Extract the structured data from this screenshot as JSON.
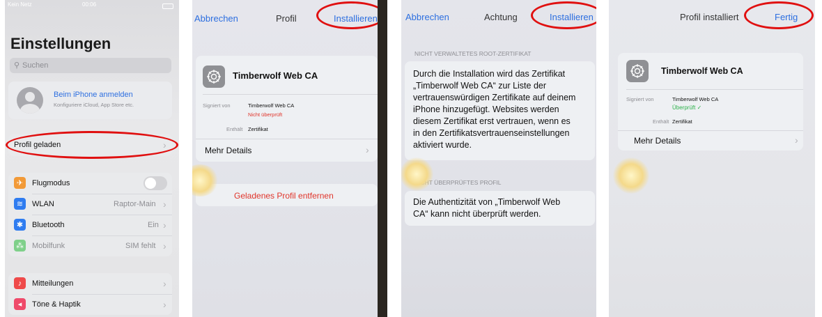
{
  "screen1": {
    "status_carrier": "Kein Netz",
    "status_time": "00:06",
    "title": "Einstellungen",
    "search_placeholder": "Suchen",
    "apple_id_title": "Beim iPhone anmelden",
    "apple_id_subtitle": "Konfiguriere iCloud, App Store etc.",
    "profile_loaded": "Profil geladen",
    "rows": [
      {
        "label": "Flugmodus",
        "value": ""
      },
      {
        "label": "WLAN",
        "value": "Raptor-Main"
      },
      {
        "label": "Bluetooth",
        "value": "Ein"
      },
      {
        "label": "Mobilfunk",
        "value": "SIM fehlt"
      }
    ],
    "rows2": [
      {
        "label": "Mitteilungen"
      },
      {
        "label": "Töne & Haptik"
      }
    ],
    "colors": {
      "airplane": "#f29a38",
      "wifi": "#2f7cf0",
      "bluetooth": "#2f7cf0",
      "cellular": "#7fd08a",
      "notifications": "#ef4a4a",
      "sounds": "#ef4a6a"
    }
  },
  "screen2": {
    "cancel": "Abbrechen",
    "title": "Profil",
    "install": "Installieren",
    "profile_name": "Timberwolf Web CA",
    "signed_label": "Signiert von",
    "signed_value": "Timberwolf Web CA",
    "signed_status": "Nicht überprüft",
    "contains_label": "Enthält",
    "contains_value": "Zertifikat",
    "more_details": "Mehr Details",
    "remove": "Geladenes Profil entfernen"
  },
  "screen3": {
    "cancel": "Abbrechen",
    "title": "Achtung",
    "install": "Installieren",
    "section1_header": "NICHT VERWALTETES ROOT-ZERTIFIKAT",
    "section1_lines": [
      "Durch die Installation wird das Zertifikat",
      "„Timberwolf Web CA“ zur Liste der",
      "vertrauenswürdigen Zertifikate auf deinem",
      "iPhone hinzugefügt. Websites werden",
      "diesem Zertifikat erst vertrauen, wenn es",
      "in den Zertifikatsvertrauenseinstellungen",
      "aktiviert wurde."
    ],
    "section2_header": "NICHT ÜBERPRÜFTES PROFIL",
    "section2_lines": [
      "Die Authentizität von „Timberwolf Web",
      "CA“ kann nicht überprüft werden."
    ]
  },
  "screen4": {
    "title": "Profil installiert",
    "done": "Fertig",
    "profile_name": "Timberwolf Web CA",
    "signed_label": "Signiert von",
    "signed_value": "Timberwolf Web CA",
    "signed_status": "Überprüft ✓",
    "contains_label": "Enthält",
    "contains_value": "Zertifikat",
    "more_details": "Mehr Details"
  }
}
